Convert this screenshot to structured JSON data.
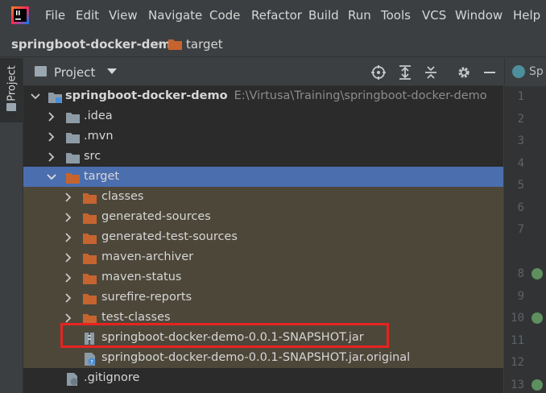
{
  "menu": {
    "items": [
      "File",
      "Edit",
      "View",
      "Navigate",
      "Code",
      "Refactor",
      "Build",
      "Run",
      "Tools",
      "VCS",
      "Window",
      "Help"
    ]
  },
  "breadcrumb": {
    "project": "springboot-docker-demo",
    "folder": "target"
  },
  "tool_strip": {
    "project_tab": "Project"
  },
  "panel": {
    "title": "Project",
    "icons": [
      "locate-icon",
      "expand-all-icon",
      "collapse-all-icon",
      "gear-icon",
      "minimize-icon"
    ]
  },
  "tree": {
    "root": {
      "name": "springboot-docker-demo",
      "path": "E:\\Virtusa\\Training\\springboot-docker-demo"
    },
    "items": [
      {
        "name": ".idea"
      },
      {
        "name": ".mvn"
      },
      {
        "name": "src"
      },
      {
        "name": "target"
      },
      {
        "name": "classes"
      },
      {
        "name": "generated-sources"
      },
      {
        "name": "generated-test-sources"
      },
      {
        "name": "maven-archiver"
      },
      {
        "name": "maven-status"
      },
      {
        "name": "surefire-reports"
      },
      {
        "name": "test-classes"
      },
      {
        "name": "springboot-docker-demo-0.0.1-SNAPSHOT.jar"
      },
      {
        "name": "springboot-docker-demo-0.0.1-SNAPSHOT.jar.original"
      },
      {
        "name": ".gitignore"
      }
    ]
  },
  "editor": {
    "tab_label": "Sp",
    "line_numbers": [
      "1",
      "2",
      "3",
      "4",
      "5",
      "6",
      "7",
      "8",
      "9",
      "10",
      "11",
      "12",
      "13"
    ]
  },
  "colors": {
    "selection": "#4b6eaf",
    "highlight": "#4d473a",
    "excluded_folder": "#c5642f",
    "folder": "#8d9ba6",
    "annotation_box": "#e8231f"
  }
}
